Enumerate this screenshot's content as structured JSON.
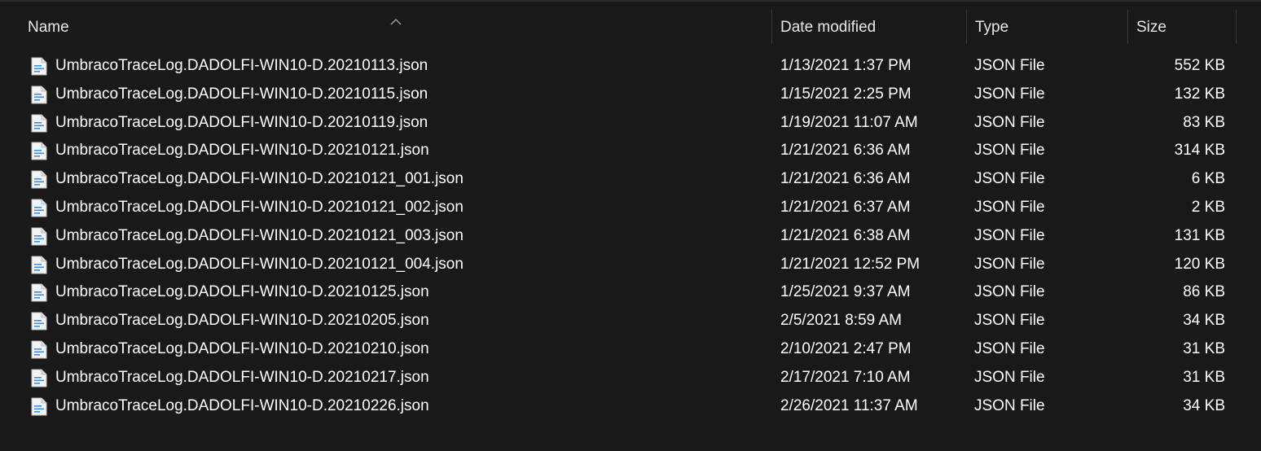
{
  "columns": {
    "name": "Name",
    "date_modified": "Date modified",
    "type": "Type",
    "size": "Size"
  },
  "sort": {
    "column": "name",
    "direction": "ascending",
    "indicator_icon": "sort-up-icon"
  },
  "colors": {
    "background": "#191919",
    "text": "#ffffff",
    "header_text": "#e8e8e8",
    "separator": "#3a3a3a",
    "icon_accent": "#3c8fd8"
  },
  "files": [
    {
      "name": "UmbracoTraceLog.DADOLFI-WIN10-D.20210113.json",
      "date": "1/13/2021 1:37 PM",
      "type": "JSON File",
      "size": "552 KB",
      "icon": "json-file-icon"
    },
    {
      "name": "UmbracoTraceLog.DADOLFI-WIN10-D.20210115.json",
      "date": "1/15/2021 2:25 PM",
      "type": "JSON File",
      "size": "132 KB",
      "icon": "json-file-icon"
    },
    {
      "name": "UmbracoTraceLog.DADOLFI-WIN10-D.20210119.json",
      "date": "1/19/2021 11:07 AM",
      "type": "JSON File",
      "size": "83 KB",
      "icon": "json-file-icon"
    },
    {
      "name": "UmbracoTraceLog.DADOLFI-WIN10-D.20210121.json",
      "date": "1/21/2021 6:36 AM",
      "type": "JSON File",
      "size": "314 KB",
      "icon": "json-file-icon"
    },
    {
      "name": "UmbracoTraceLog.DADOLFI-WIN10-D.20210121_001.json",
      "date": "1/21/2021 6:36 AM",
      "type": "JSON File",
      "size": "6 KB",
      "icon": "json-file-icon"
    },
    {
      "name": "UmbracoTraceLog.DADOLFI-WIN10-D.20210121_002.json",
      "date": "1/21/2021 6:37 AM",
      "type": "JSON File",
      "size": "2 KB",
      "icon": "json-file-icon"
    },
    {
      "name": "UmbracoTraceLog.DADOLFI-WIN10-D.20210121_003.json",
      "date": "1/21/2021 6:38 AM",
      "type": "JSON File",
      "size": "131 KB",
      "icon": "json-file-icon"
    },
    {
      "name": "UmbracoTraceLog.DADOLFI-WIN10-D.20210121_004.json",
      "date": "1/21/2021 12:52 PM",
      "type": "JSON File",
      "size": "120 KB",
      "icon": "json-file-icon"
    },
    {
      "name": "UmbracoTraceLog.DADOLFI-WIN10-D.20210125.json",
      "date": "1/25/2021 9:37 AM",
      "type": "JSON File",
      "size": "86 KB",
      "icon": "json-file-icon"
    },
    {
      "name": "UmbracoTraceLog.DADOLFI-WIN10-D.20210205.json",
      "date": "2/5/2021 8:59 AM",
      "type": "JSON File",
      "size": "34 KB",
      "icon": "json-file-icon"
    },
    {
      "name": "UmbracoTraceLog.DADOLFI-WIN10-D.20210210.json",
      "date": "2/10/2021 2:47 PM",
      "type": "JSON File",
      "size": "31 KB",
      "icon": "json-file-icon"
    },
    {
      "name": "UmbracoTraceLog.DADOLFI-WIN10-D.20210217.json",
      "date": "2/17/2021 7:10 AM",
      "type": "JSON File",
      "size": "31 KB",
      "icon": "json-file-icon"
    },
    {
      "name": "UmbracoTraceLog.DADOLFI-WIN10-D.20210226.json",
      "date": "2/26/2021 11:37 AM",
      "type": "JSON File",
      "size": "34 KB",
      "icon": "json-file-icon"
    }
  ]
}
